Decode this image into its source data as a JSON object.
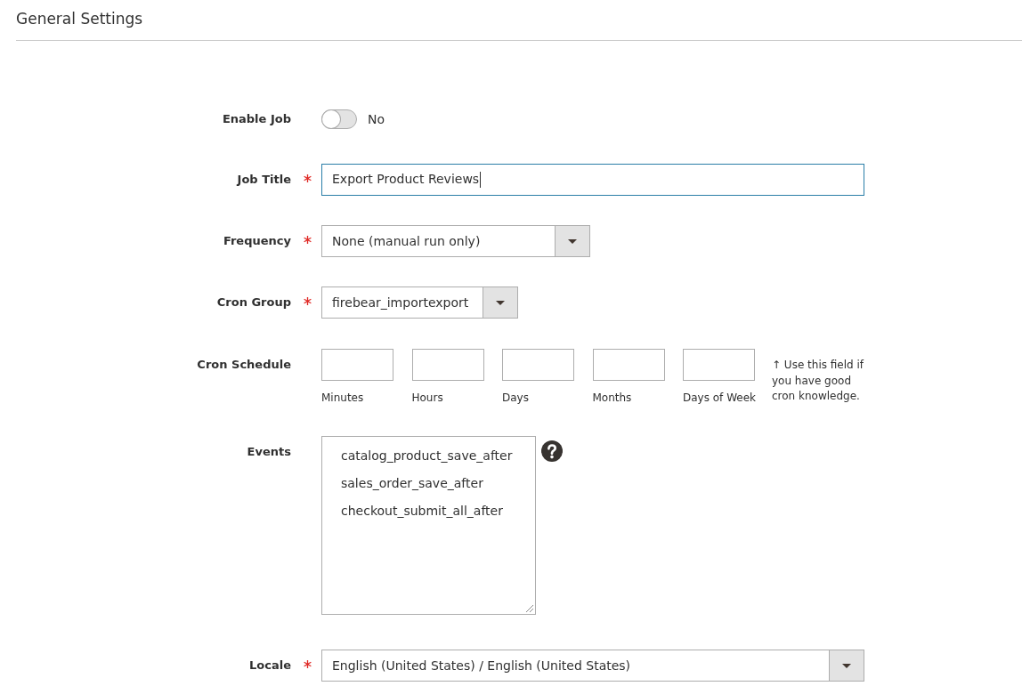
{
  "section_title": "General Settings",
  "fields": [
    {
      "kind": "toggle",
      "label": "Enable Job",
      "required": false,
      "on": false,
      "state_label": "No"
    },
    {
      "kind": "text",
      "label": "Job Title",
      "required": true,
      "value": "Export Product Reviews",
      "focused": true
    },
    {
      "kind": "select",
      "label": "Frequency",
      "required": true,
      "value": "None (manual run only)"
    },
    {
      "kind": "select",
      "label": "Cron Group",
      "required": true,
      "value": "firebear_importexport"
    },
    {
      "kind": "cron",
      "label": "Cron Schedule",
      "required": false,
      "parts": [
        {
          "caption": "Minutes"
        },
        {
          "caption": "Hours"
        },
        {
          "caption": "Days"
        },
        {
          "caption": "Months"
        },
        {
          "caption": "Days of Week"
        }
      ],
      "note": "↑ Use this field if you have good cron knowledge."
    },
    {
      "kind": "multiselect",
      "label": "Events",
      "required": false,
      "options": [
        {
          "label": "catalog_product_save_after",
          "selected": false
        },
        {
          "label": "sales_order_save_after",
          "selected": false
        },
        {
          "label": "checkout_submit_all_after",
          "selected": false
        }
      ],
      "help": true
    },
    {
      "kind": "select",
      "label": "Locale",
      "required": true,
      "value": "English (United States) / English (United States)"
    }
  ]
}
